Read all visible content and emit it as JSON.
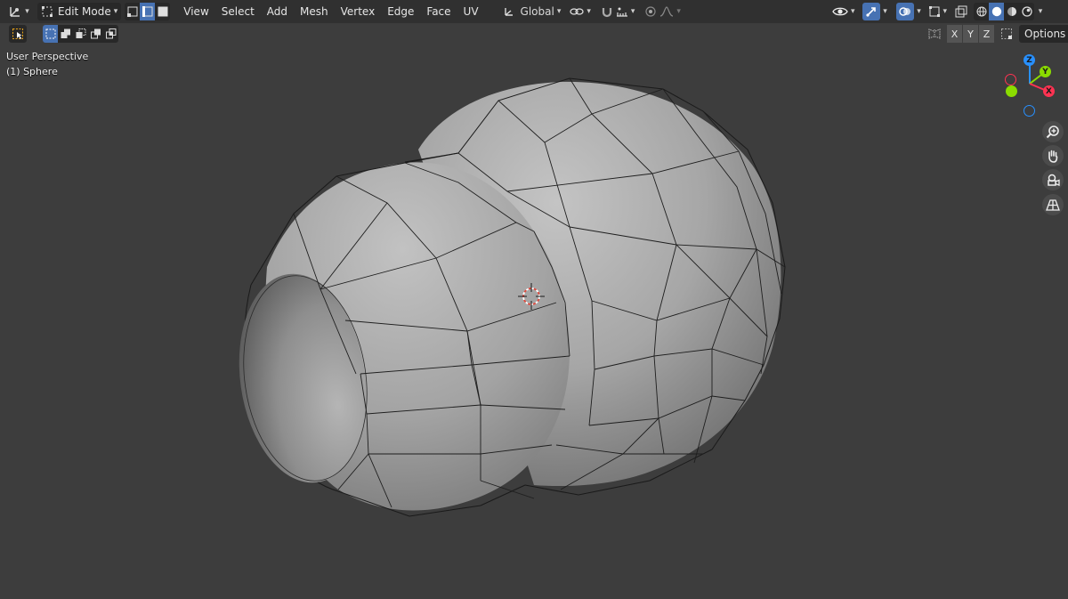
{
  "header": {
    "editor_type_icon": "transform-gizmo-icon",
    "mode": "Edit Mode",
    "select_modes": [
      "vertex",
      "edge",
      "face"
    ],
    "select_mode_active": "edge",
    "menus": [
      "View",
      "Select",
      "Add",
      "Mesh",
      "Vertex",
      "Edge",
      "Face",
      "UV"
    ],
    "orientation": "Global",
    "right_icons": [
      "visibility-eye-icon",
      "gizmo-icon",
      "overlay-icon",
      "xray-icon"
    ],
    "shading_modes": [
      "wireframe",
      "solid",
      "material",
      "rendered"
    ],
    "shading_active": "solid"
  },
  "subheader": {
    "mirror_axes": [
      "X",
      "Y",
      "Z"
    ],
    "options_label": "Options"
  },
  "viewport": {
    "perspective_label": "User Perspective",
    "object_label": "(1) Sphere"
  },
  "gizmo": {
    "z_label": "Z",
    "y_label": "Y",
    "x_label": "X",
    "colors": {
      "x": "#ff3352",
      "y": "#8bdc00",
      "z": "#2890ff"
    }
  },
  "nav_icons": [
    "zoom-icon",
    "hand-pan-icon",
    "camera-icon",
    "perspective-grid-icon"
  ],
  "colors": {
    "background": "#3d3d3d",
    "header": "#303030",
    "active": "#4772b3",
    "mesh": "#9a9a9a"
  }
}
